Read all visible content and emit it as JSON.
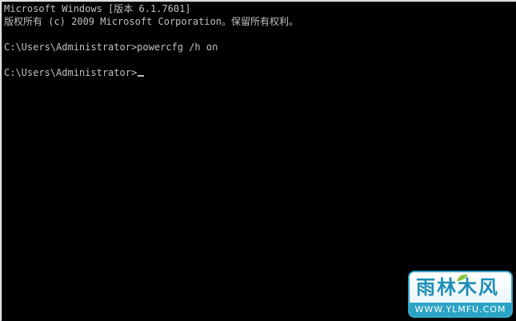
{
  "console": {
    "lines": [
      "Microsoft Windows [版本 6.1.7601]",
      "版权所有 (c) 2009 Microsoft Corporation。保留所有权利。",
      "C:\\Users\\Administrator>powercfg /h on",
      "C:\\Users\\Administrator>"
    ],
    "text_color": "#c0c0c0",
    "background": "#000000"
  },
  "watermark": {
    "brand": "雨林木风",
    "url": "WWW.YLMFU.COM",
    "accent": "#2aa3c6"
  }
}
